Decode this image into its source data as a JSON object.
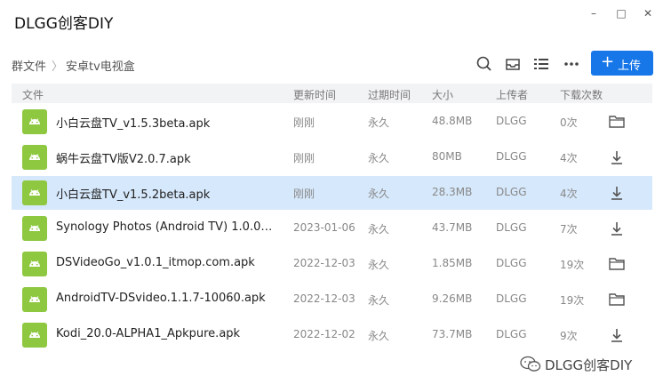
{
  "window": {
    "title": "DLGG创客DIY",
    "minimize_glyph": "–",
    "maximize_glyph": "□",
    "close_glyph": "✕"
  },
  "breadcrumb": {
    "root": "群文件",
    "separator": "〉",
    "current": "安卓tv电视盒"
  },
  "toolbar": {
    "upload_label": "上传",
    "upload_plus": "+",
    "accent_color": "#1777e8",
    "icons": [
      "search-icon",
      "inbox-icon",
      "list-view-icon",
      "more-icon"
    ]
  },
  "table": {
    "headers": {
      "file": "文件",
      "updated": "更新时间",
      "expires": "过期时间",
      "size": "大小",
      "uploader": "上传者",
      "downloads": "下载次数"
    },
    "rows": [
      {
        "name": "小白云盘TV_v1.5.3beta.apk",
        "updated": "刚刚",
        "expires": "永久",
        "size": "48.8MB",
        "uploader": "DLGG",
        "downloads": "0次",
        "action_icon": "folder-icon",
        "selected": false
      },
      {
        "name": "蜗牛云盘TV版V2.0.7.apk",
        "updated": "刚刚",
        "expires": "永久",
        "size": "80MB",
        "uploader": "DLGG",
        "downloads": "4次",
        "action_icon": "download-icon",
        "selected": false
      },
      {
        "name": "小白云盘TV_v1.5.2beta.apk",
        "updated": "刚刚",
        "expires": "永久",
        "size": "28.3MB",
        "uploader": "DLGG",
        "downloads": "4次",
        "action_icon": "download-icon",
        "selected": true
      },
      {
        "name": "Synology Photos (Android TV) 1.0.0-100...",
        "updated": "2023-01-06",
        "expires": "永久",
        "size": "43.7MB",
        "uploader": "DLGG",
        "downloads": "7次",
        "action_icon": "download-icon",
        "selected": false
      },
      {
        "name": "DSVideoGo_v1.0.1_itmop.com.apk",
        "updated": "2022-12-03",
        "expires": "永久",
        "size": "1.85MB",
        "uploader": "DLGG",
        "downloads": "19次",
        "action_icon": "folder-icon",
        "selected": false
      },
      {
        "name": "AndroidTV-DSvideo.1.1.7-10060.apk",
        "updated": "2022-12-03",
        "expires": "永久",
        "size": "9.26MB",
        "uploader": "DLGG",
        "downloads": "19次",
        "action_icon": "folder-icon",
        "selected": false
      },
      {
        "name": "Kodi_20.0-ALPHA1_Apkpure.apk",
        "updated": "2022-12-02",
        "expires": "永久",
        "size": "73.7MB",
        "uploader": "DLGG",
        "downloads": "9次",
        "action_icon": "download-icon",
        "selected": false
      }
    ],
    "file_icon": "android-apk-icon",
    "file_icon_color": "#8ec840",
    "selected_row_color": "#d6e8fb"
  },
  "watermark": {
    "text": "DLGG创客DIY",
    "icon": "wechat-icon"
  }
}
